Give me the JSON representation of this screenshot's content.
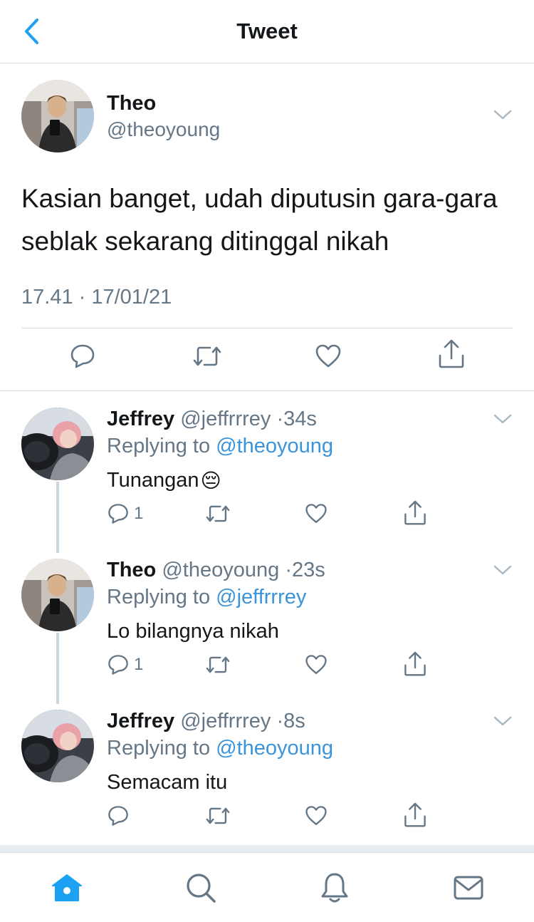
{
  "header": {
    "title": "Tweet",
    "back_icon": "chevron-left-icon"
  },
  "main_tweet": {
    "name": "Theo",
    "handle": "@theoyoung",
    "text": "Kasian banget, udah diputusin gara-gara seblak sekarang ditinggal nikah",
    "timestamp": "17.41 · 17/01/21",
    "actions": [
      "reply-icon",
      "retweet-icon",
      "like-icon",
      "share-icon"
    ]
  },
  "replies": [
    {
      "name": "Jeffrey",
      "handle": "@jeffrrrey",
      "time": "34s",
      "replying_label": "Replying to",
      "replying_to": "@theoyoung",
      "text": "Tunangan",
      "emoji": "😔",
      "reply_count": "1"
    },
    {
      "name": "Theo",
      "handle": "@theoyoung",
      "time": "23s",
      "replying_label": "Replying to",
      "replying_to": "@jeffrrrey",
      "text": "Lo bilangnya nikah",
      "emoji": "",
      "reply_count": "1"
    },
    {
      "name": "Jeffrey",
      "handle": "@jeffrrrey",
      "time": "8s",
      "replying_label": "Replying to",
      "replying_to": "@theoyoung",
      "text": "Semacam itu",
      "emoji": "",
      "reply_count": ""
    }
  ],
  "tabbar": {
    "items": [
      "home-icon",
      "search-icon",
      "notifications-icon",
      "messages-icon"
    ],
    "active": "home-icon"
  },
  "colors": {
    "accent": "#1da1f2",
    "text": "#14171a",
    "secondary": "#657786",
    "border": "#d8dde2"
  }
}
